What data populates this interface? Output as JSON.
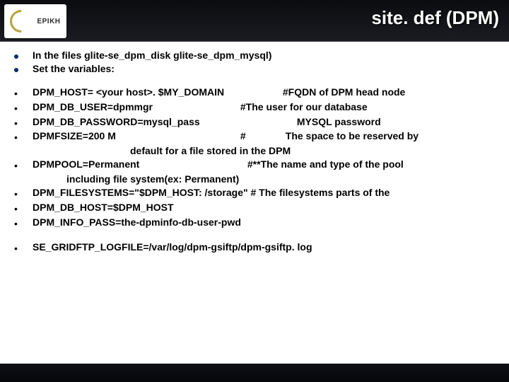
{
  "header": {
    "logo_text": "EPIKH",
    "title": "site. def (DPM)"
  },
  "intro": {
    "line1": "In the  files glite-se_dpm_disk glite-se_dpm_mysql)",
    "line2": "Set the variables:"
  },
  "lines": {
    "l1a": "DPM_HOST= <your host>. $MY_DOMAIN",
    "l1b": "#FQDN of DPM head node",
    "l2a": "DPM_DB_USER=dpmmgr",
    "l2b": "#The user for our database",
    "l3a": "DPM_DB_PASSWORD=mysql_pass",
    "l3b": "MYSQL password",
    "l4a": "DPMFSIZE=200 M",
    "l4b": "#",
    "l4c": "The space to be reserved by",
    "center1": "default for a file stored in the DPM",
    "l5a": "DPMPOOL=Permanent",
    "l5b": "#**The name and type of the pool",
    "center2": "including file system(ex: Permanent)",
    "l6": "DPM_FILESYSTEMS=\"$DPM_HOST: /storage\"  # The filesystems parts of the",
    "l7": "DPM_DB_HOST=$DPM_HOST",
    "l8": " DPM_INFO_PASS=the-dpminfo-db-user-pwd",
    "l9": "SE_GRIDFTP_LOGFILE=/var/log/dpm-gsiftp/dpm-gsiftp. log"
  }
}
